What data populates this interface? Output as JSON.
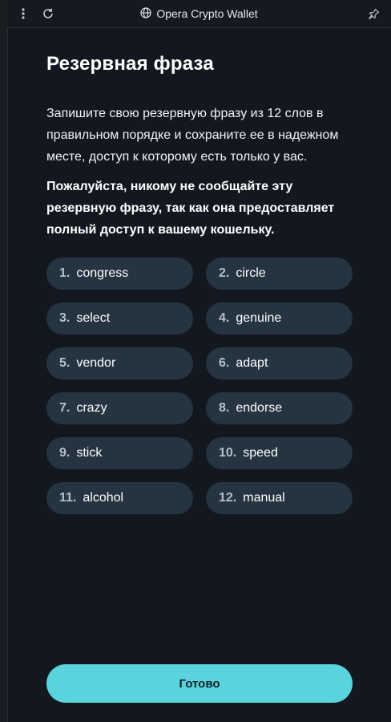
{
  "window": {
    "title": "Opera Crypto Wallet"
  },
  "page": {
    "title": "Резервная фраза",
    "instruction": "Запишите свою резервную фразу из 12 слов в правильном порядке и сохраните ее в надежном месте, доступ к которому есть только у вас.",
    "warning": "Пожалуйста, никому не сообщайте эту резервную фразу, так как она предоставляет полный доступ к вашему кошельку."
  },
  "words": [
    {
      "num": "1.",
      "word": "congress"
    },
    {
      "num": "2.",
      "word": "circle"
    },
    {
      "num": "3.",
      "word": "select"
    },
    {
      "num": "4.",
      "word": "genuine"
    },
    {
      "num": "5.",
      "word": "vendor"
    },
    {
      "num": "6.",
      "word": "adapt"
    },
    {
      "num": "7.",
      "word": "crazy"
    },
    {
      "num": "8.",
      "word": "endorse"
    },
    {
      "num": "9.",
      "word": "stick"
    },
    {
      "num": "10.",
      "word": "speed"
    },
    {
      "num": "11.",
      "word": "alcohol"
    },
    {
      "num": "12.",
      "word": "manual"
    }
  ],
  "done_button": {
    "label": "Готово"
  },
  "icons": {
    "menu": "kebab-icon",
    "reload": "reload-icon",
    "title": "globe-icon",
    "pin": "pin-icon"
  },
  "colors": {
    "background": "#13171f",
    "chip": "#263442",
    "accent": "#5ad3dc"
  }
}
